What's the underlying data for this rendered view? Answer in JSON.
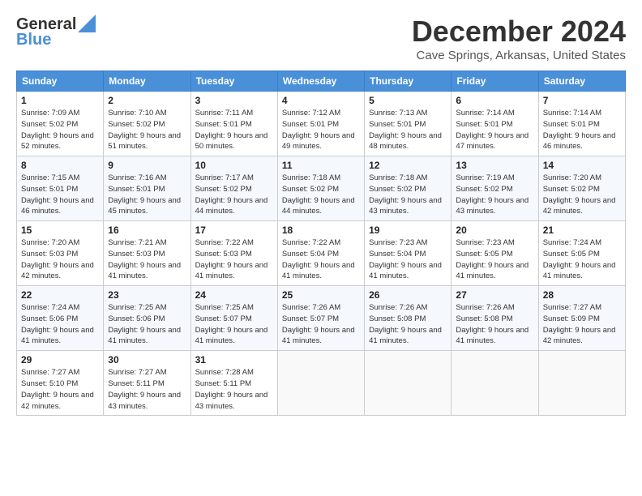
{
  "logo": {
    "text1": "General",
    "text2": "Blue"
  },
  "title": "December 2024",
  "location": "Cave Springs, Arkansas, United States",
  "headers": [
    "Sunday",
    "Monday",
    "Tuesday",
    "Wednesday",
    "Thursday",
    "Friday",
    "Saturday"
  ],
  "weeks": [
    [
      {
        "day": "1",
        "sunrise": "Sunrise: 7:09 AM",
        "sunset": "Sunset: 5:02 PM",
        "daylight": "Daylight: 9 hours and 52 minutes."
      },
      {
        "day": "2",
        "sunrise": "Sunrise: 7:10 AM",
        "sunset": "Sunset: 5:02 PM",
        "daylight": "Daylight: 9 hours and 51 minutes."
      },
      {
        "day": "3",
        "sunrise": "Sunrise: 7:11 AM",
        "sunset": "Sunset: 5:01 PM",
        "daylight": "Daylight: 9 hours and 50 minutes."
      },
      {
        "day": "4",
        "sunrise": "Sunrise: 7:12 AM",
        "sunset": "Sunset: 5:01 PM",
        "daylight": "Daylight: 9 hours and 49 minutes."
      },
      {
        "day": "5",
        "sunrise": "Sunrise: 7:13 AM",
        "sunset": "Sunset: 5:01 PM",
        "daylight": "Daylight: 9 hours and 48 minutes."
      },
      {
        "day": "6",
        "sunrise": "Sunrise: 7:14 AM",
        "sunset": "Sunset: 5:01 PM",
        "daylight": "Daylight: 9 hours and 47 minutes."
      },
      {
        "day": "7",
        "sunrise": "Sunrise: 7:14 AM",
        "sunset": "Sunset: 5:01 PM",
        "daylight": "Daylight: 9 hours and 46 minutes."
      }
    ],
    [
      {
        "day": "8",
        "sunrise": "Sunrise: 7:15 AM",
        "sunset": "Sunset: 5:01 PM",
        "daylight": "Daylight: 9 hours and 46 minutes."
      },
      {
        "day": "9",
        "sunrise": "Sunrise: 7:16 AM",
        "sunset": "Sunset: 5:01 PM",
        "daylight": "Daylight: 9 hours and 45 minutes."
      },
      {
        "day": "10",
        "sunrise": "Sunrise: 7:17 AM",
        "sunset": "Sunset: 5:02 PM",
        "daylight": "Daylight: 9 hours and 44 minutes."
      },
      {
        "day": "11",
        "sunrise": "Sunrise: 7:18 AM",
        "sunset": "Sunset: 5:02 PM",
        "daylight": "Daylight: 9 hours and 44 minutes."
      },
      {
        "day": "12",
        "sunrise": "Sunrise: 7:18 AM",
        "sunset": "Sunset: 5:02 PM",
        "daylight": "Daylight: 9 hours and 43 minutes."
      },
      {
        "day": "13",
        "sunrise": "Sunrise: 7:19 AM",
        "sunset": "Sunset: 5:02 PM",
        "daylight": "Daylight: 9 hours and 43 minutes."
      },
      {
        "day": "14",
        "sunrise": "Sunrise: 7:20 AM",
        "sunset": "Sunset: 5:02 PM",
        "daylight": "Daylight: 9 hours and 42 minutes."
      }
    ],
    [
      {
        "day": "15",
        "sunrise": "Sunrise: 7:20 AM",
        "sunset": "Sunset: 5:03 PM",
        "daylight": "Daylight: 9 hours and 42 minutes."
      },
      {
        "day": "16",
        "sunrise": "Sunrise: 7:21 AM",
        "sunset": "Sunset: 5:03 PM",
        "daylight": "Daylight: 9 hours and 41 minutes."
      },
      {
        "day": "17",
        "sunrise": "Sunrise: 7:22 AM",
        "sunset": "Sunset: 5:03 PM",
        "daylight": "Daylight: 9 hours and 41 minutes."
      },
      {
        "day": "18",
        "sunrise": "Sunrise: 7:22 AM",
        "sunset": "Sunset: 5:04 PM",
        "daylight": "Daylight: 9 hours and 41 minutes."
      },
      {
        "day": "19",
        "sunrise": "Sunrise: 7:23 AM",
        "sunset": "Sunset: 5:04 PM",
        "daylight": "Daylight: 9 hours and 41 minutes."
      },
      {
        "day": "20",
        "sunrise": "Sunrise: 7:23 AM",
        "sunset": "Sunset: 5:05 PM",
        "daylight": "Daylight: 9 hours and 41 minutes."
      },
      {
        "day": "21",
        "sunrise": "Sunrise: 7:24 AM",
        "sunset": "Sunset: 5:05 PM",
        "daylight": "Daylight: 9 hours and 41 minutes."
      }
    ],
    [
      {
        "day": "22",
        "sunrise": "Sunrise: 7:24 AM",
        "sunset": "Sunset: 5:06 PM",
        "daylight": "Daylight: 9 hours and 41 minutes."
      },
      {
        "day": "23",
        "sunrise": "Sunrise: 7:25 AM",
        "sunset": "Sunset: 5:06 PM",
        "daylight": "Daylight: 9 hours and 41 minutes."
      },
      {
        "day": "24",
        "sunrise": "Sunrise: 7:25 AM",
        "sunset": "Sunset: 5:07 PM",
        "daylight": "Daylight: 9 hours and 41 minutes."
      },
      {
        "day": "25",
        "sunrise": "Sunrise: 7:26 AM",
        "sunset": "Sunset: 5:07 PM",
        "daylight": "Daylight: 9 hours and 41 minutes."
      },
      {
        "day": "26",
        "sunrise": "Sunrise: 7:26 AM",
        "sunset": "Sunset: 5:08 PM",
        "daylight": "Daylight: 9 hours and 41 minutes."
      },
      {
        "day": "27",
        "sunrise": "Sunrise: 7:26 AM",
        "sunset": "Sunset: 5:08 PM",
        "daylight": "Daylight: 9 hours and 41 minutes."
      },
      {
        "day": "28",
        "sunrise": "Sunrise: 7:27 AM",
        "sunset": "Sunset: 5:09 PM",
        "daylight": "Daylight: 9 hours and 42 minutes."
      }
    ],
    [
      {
        "day": "29",
        "sunrise": "Sunrise: 7:27 AM",
        "sunset": "Sunset: 5:10 PM",
        "daylight": "Daylight: 9 hours and 42 minutes."
      },
      {
        "day": "30",
        "sunrise": "Sunrise: 7:27 AM",
        "sunset": "Sunset: 5:11 PM",
        "daylight": "Daylight: 9 hours and 43 minutes."
      },
      {
        "day": "31",
        "sunrise": "Sunrise: 7:28 AM",
        "sunset": "Sunset: 5:11 PM",
        "daylight": "Daylight: 9 hours and 43 minutes."
      },
      null,
      null,
      null,
      null
    ]
  ]
}
